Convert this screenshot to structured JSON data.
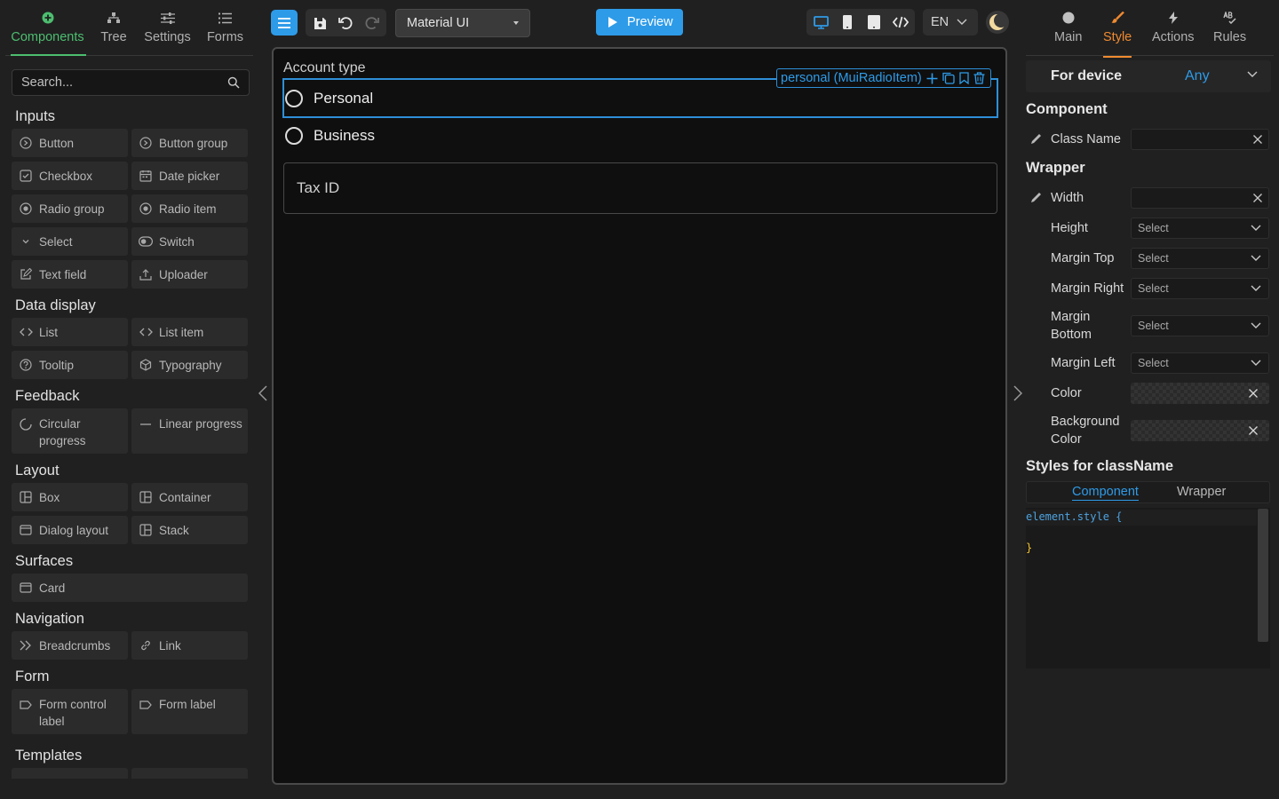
{
  "left_tabs": [
    {
      "label": "Components",
      "active": true
    },
    {
      "label": "Tree",
      "active": false
    },
    {
      "label": "Settings",
      "active": false
    },
    {
      "label": "Forms",
      "active": false
    }
  ],
  "search": {
    "placeholder": "Search..."
  },
  "sections": {
    "inputs": {
      "title": "Inputs",
      "items": [
        "Button",
        "Button group",
        "Checkbox",
        "Date picker",
        "Radio group",
        "Radio item",
        "Select",
        "Switch",
        "Text field",
        "Uploader"
      ]
    },
    "data_display": {
      "title": "Data display",
      "items": [
        "List",
        "List item",
        "Tooltip",
        "Typography"
      ]
    },
    "feedback": {
      "title": "Feedback",
      "items": [
        "Circular progress",
        "Linear progress"
      ]
    },
    "layout": {
      "title": "Layout",
      "items": [
        "Box",
        "Container",
        "Dialog layout",
        "Stack"
      ]
    },
    "surfaces": {
      "title": "Surfaces",
      "items": [
        "Card"
      ]
    },
    "navigation": {
      "title": "Navigation",
      "items": [
        "Breadcrumbs",
        "Link"
      ]
    },
    "form": {
      "title": "Form",
      "items": [
        "Form control label",
        "Form label"
      ]
    },
    "templates": {
      "title": "Templates",
      "items": []
    }
  },
  "toolbar": {
    "framework": "Material UI",
    "preview_label": "Preview",
    "language": "EN",
    "accent_color": "#2e9be8"
  },
  "canvas": {
    "radio_group_label": "Account type",
    "options": [
      "Personal",
      "Business"
    ],
    "selected_badge": "personal (MuiRadioItem)",
    "tax_field_label": "Tax ID"
  },
  "right_tabs": [
    {
      "label": "Main",
      "active": false
    },
    {
      "label": "Style",
      "active": true
    },
    {
      "label": "Actions",
      "active": false
    },
    {
      "label": "Rules",
      "active": false
    }
  ],
  "style_panel": {
    "device_label": "For device",
    "device_value": "Any",
    "component_title": "Component",
    "class_name_label": "Class Name",
    "class_name_value": "",
    "wrapper_title": "Wrapper",
    "width_label": "Width",
    "width_value": "",
    "height_label": "Height",
    "margin_top_label": "Margin Top",
    "margin_right_label": "Margin Right",
    "margin_bottom_label": "Margin Bottom",
    "margin_left_label": "Margin Left",
    "select_placeholder": "Select",
    "color_label": "Color",
    "bg_color_label": "Background Color",
    "styles_title": "Styles for className",
    "style_tabs": [
      "Component",
      "Wrapper"
    ],
    "code_line1": "element.style {",
    "code_line2": "}"
  }
}
